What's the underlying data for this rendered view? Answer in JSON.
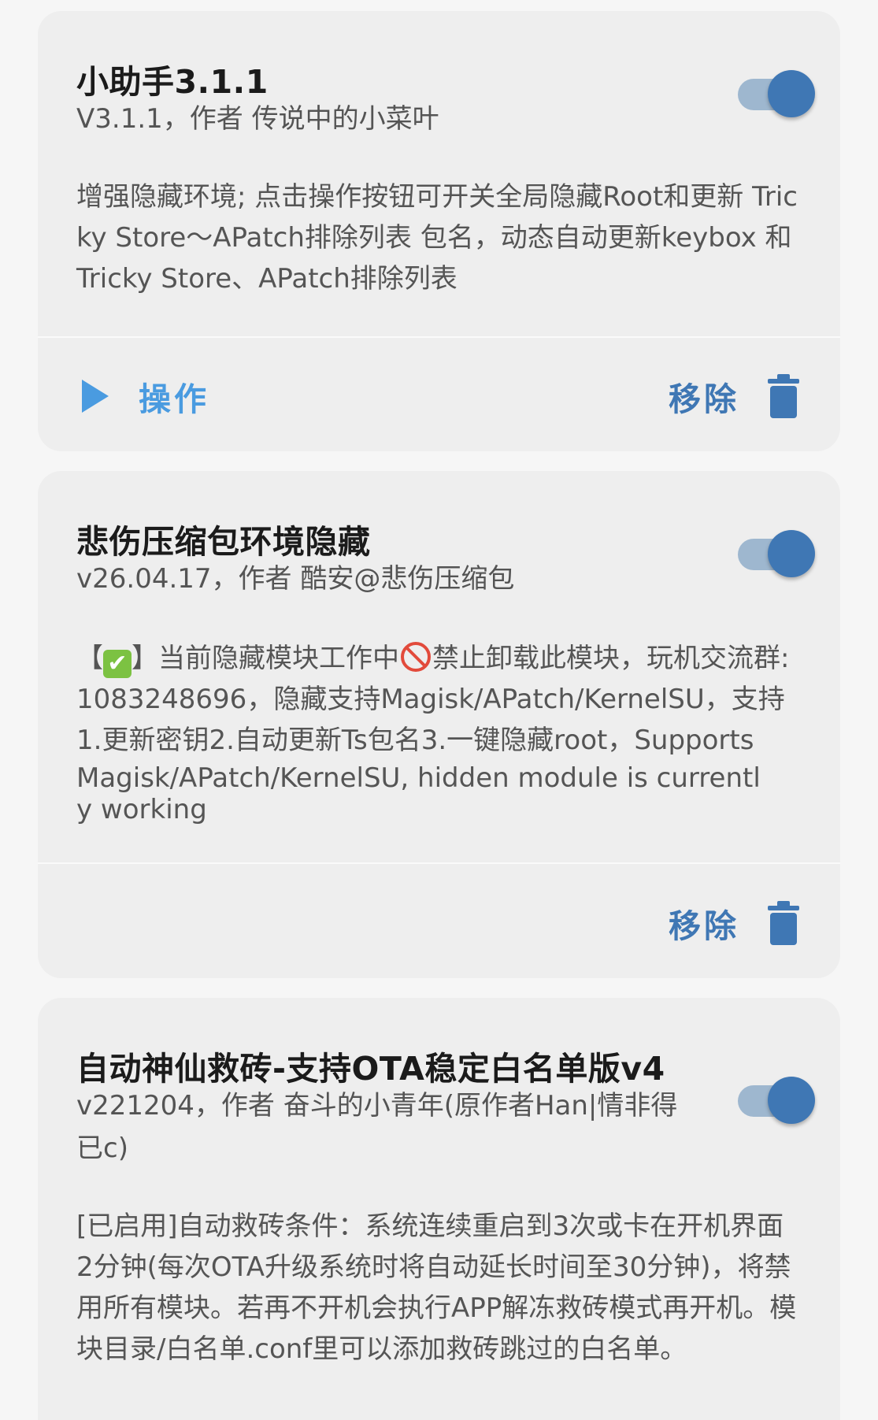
{
  "modules": [
    {
      "title": "小助手3.1.1",
      "meta": "V3.1.1，作者 传说中的小菜叶",
      "description": "增强隐藏环境; 点击操作按钮可开关全局隐藏Root和更新 Tricky Store～APatch排除列表 包名，动态自动更新keybox 和 Tricky Store、APatch排除列表",
      "enabled": true,
      "action_label": "操作",
      "remove_label": "移除"
    },
    {
      "title": "悲伤压缩包环境隐藏",
      "meta": "v26.04.17，作者 酷安@悲伤压缩包",
      "description_prefix": "【",
      "description_mid1": "】当前隐藏模块工作中",
      "description_mid2": "禁止卸载此模块，玩机交流群:1083248696，隐藏支持Magisk/APatch/KernelSU，支持1.更新密钥2.自动更新Ts包名3.一键隐藏root，Supports",
      "description_en": "Magisk/APatch/KernelSU, hidden module is currently working",
      "check_emoji": "✔",
      "enabled": true,
      "remove_label": "移除"
    },
    {
      "title": "自动神仙救砖-支持OTA稳定白名单版v4",
      "meta": "v221204，作者 奋斗的小青年(原作者Han|情非得已c)",
      "description": "[已启用]自动救砖条件：系统连续重启到3次或卡在开机界面2分钟(每次OTA升级系统时将自动延长时间至30分钟)，将禁用所有模块。若再不开机会执行APP解冻救砖模式再开机。模块目录/白名单.conf里可以添加救砖跳过的白名单。",
      "enabled": true
    }
  ],
  "colors": {
    "accent": "#3f77b4",
    "action": "#4a9be0",
    "card_bg": "#eeeeee",
    "page_bg": "#f6f6f6"
  },
  "icons": {
    "action": "play-icon",
    "remove": "trash-icon",
    "toggle": "switch-on"
  }
}
